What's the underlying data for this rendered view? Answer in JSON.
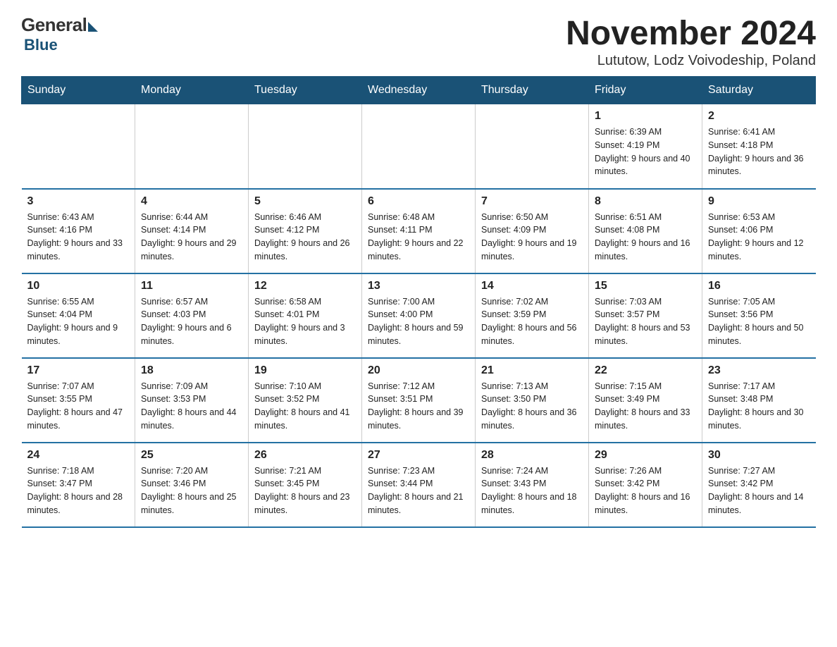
{
  "logo": {
    "general": "General",
    "blue": "Blue"
  },
  "header": {
    "month": "November 2024",
    "location": "Lututow, Lodz Voivodeship, Poland"
  },
  "weekdays": [
    "Sunday",
    "Monday",
    "Tuesday",
    "Wednesday",
    "Thursday",
    "Friday",
    "Saturday"
  ],
  "weeks": [
    [
      {
        "day": "",
        "info": ""
      },
      {
        "day": "",
        "info": ""
      },
      {
        "day": "",
        "info": ""
      },
      {
        "day": "",
        "info": ""
      },
      {
        "day": "",
        "info": ""
      },
      {
        "day": "1",
        "info": "Sunrise: 6:39 AM\nSunset: 4:19 PM\nDaylight: 9 hours and 40 minutes."
      },
      {
        "day": "2",
        "info": "Sunrise: 6:41 AM\nSunset: 4:18 PM\nDaylight: 9 hours and 36 minutes."
      }
    ],
    [
      {
        "day": "3",
        "info": "Sunrise: 6:43 AM\nSunset: 4:16 PM\nDaylight: 9 hours and 33 minutes."
      },
      {
        "day": "4",
        "info": "Sunrise: 6:44 AM\nSunset: 4:14 PM\nDaylight: 9 hours and 29 minutes."
      },
      {
        "day": "5",
        "info": "Sunrise: 6:46 AM\nSunset: 4:12 PM\nDaylight: 9 hours and 26 minutes."
      },
      {
        "day": "6",
        "info": "Sunrise: 6:48 AM\nSunset: 4:11 PM\nDaylight: 9 hours and 22 minutes."
      },
      {
        "day": "7",
        "info": "Sunrise: 6:50 AM\nSunset: 4:09 PM\nDaylight: 9 hours and 19 minutes."
      },
      {
        "day": "8",
        "info": "Sunrise: 6:51 AM\nSunset: 4:08 PM\nDaylight: 9 hours and 16 minutes."
      },
      {
        "day": "9",
        "info": "Sunrise: 6:53 AM\nSunset: 4:06 PM\nDaylight: 9 hours and 12 minutes."
      }
    ],
    [
      {
        "day": "10",
        "info": "Sunrise: 6:55 AM\nSunset: 4:04 PM\nDaylight: 9 hours and 9 minutes."
      },
      {
        "day": "11",
        "info": "Sunrise: 6:57 AM\nSunset: 4:03 PM\nDaylight: 9 hours and 6 minutes."
      },
      {
        "day": "12",
        "info": "Sunrise: 6:58 AM\nSunset: 4:01 PM\nDaylight: 9 hours and 3 minutes."
      },
      {
        "day": "13",
        "info": "Sunrise: 7:00 AM\nSunset: 4:00 PM\nDaylight: 8 hours and 59 minutes."
      },
      {
        "day": "14",
        "info": "Sunrise: 7:02 AM\nSunset: 3:59 PM\nDaylight: 8 hours and 56 minutes."
      },
      {
        "day": "15",
        "info": "Sunrise: 7:03 AM\nSunset: 3:57 PM\nDaylight: 8 hours and 53 minutes."
      },
      {
        "day": "16",
        "info": "Sunrise: 7:05 AM\nSunset: 3:56 PM\nDaylight: 8 hours and 50 minutes."
      }
    ],
    [
      {
        "day": "17",
        "info": "Sunrise: 7:07 AM\nSunset: 3:55 PM\nDaylight: 8 hours and 47 minutes."
      },
      {
        "day": "18",
        "info": "Sunrise: 7:09 AM\nSunset: 3:53 PM\nDaylight: 8 hours and 44 minutes."
      },
      {
        "day": "19",
        "info": "Sunrise: 7:10 AM\nSunset: 3:52 PM\nDaylight: 8 hours and 41 minutes."
      },
      {
        "day": "20",
        "info": "Sunrise: 7:12 AM\nSunset: 3:51 PM\nDaylight: 8 hours and 39 minutes."
      },
      {
        "day": "21",
        "info": "Sunrise: 7:13 AM\nSunset: 3:50 PM\nDaylight: 8 hours and 36 minutes."
      },
      {
        "day": "22",
        "info": "Sunrise: 7:15 AM\nSunset: 3:49 PM\nDaylight: 8 hours and 33 minutes."
      },
      {
        "day": "23",
        "info": "Sunrise: 7:17 AM\nSunset: 3:48 PM\nDaylight: 8 hours and 30 minutes."
      }
    ],
    [
      {
        "day": "24",
        "info": "Sunrise: 7:18 AM\nSunset: 3:47 PM\nDaylight: 8 hours and 28 minutes."
      },
      {
        "day": "25",
        "info": "Sunrise: 7:20 AM\nSunset: 3:46 PM\nDaylight: 8 hours and 25 minutes."
      },
      {
        "day": "26",
        "info": "Sunrise: 7:21 AM\nSunset: 3:45 PM\nDaylight: 8 hours and 23 minutes."
      },
      {
        "day": "27",
        "info": "Sunrise: 7:23 AM\nSunset: 3:44 PM\nDaylight: 8 hours and 21 minutes."
      },
      {
        "day": "28",
        "info": "Sunrise: 7:24 AM\nSunset: 3:43 PM\nDaylight: 8 hours and 18 minutes."
      },
      {
        "day": "29",
        "info": "Sunrise: 7:26 AM\nSunset: 3:42 PM\nDaylight: 8 hours and 16 minutes."
      },
      {
        "day": "30",
        "info": "Sunrise: 7:27 AM\nSunset: 3:42 PM\nDaylight: 8 hours and 14 minutes."
      }
    ]
  ]
}
